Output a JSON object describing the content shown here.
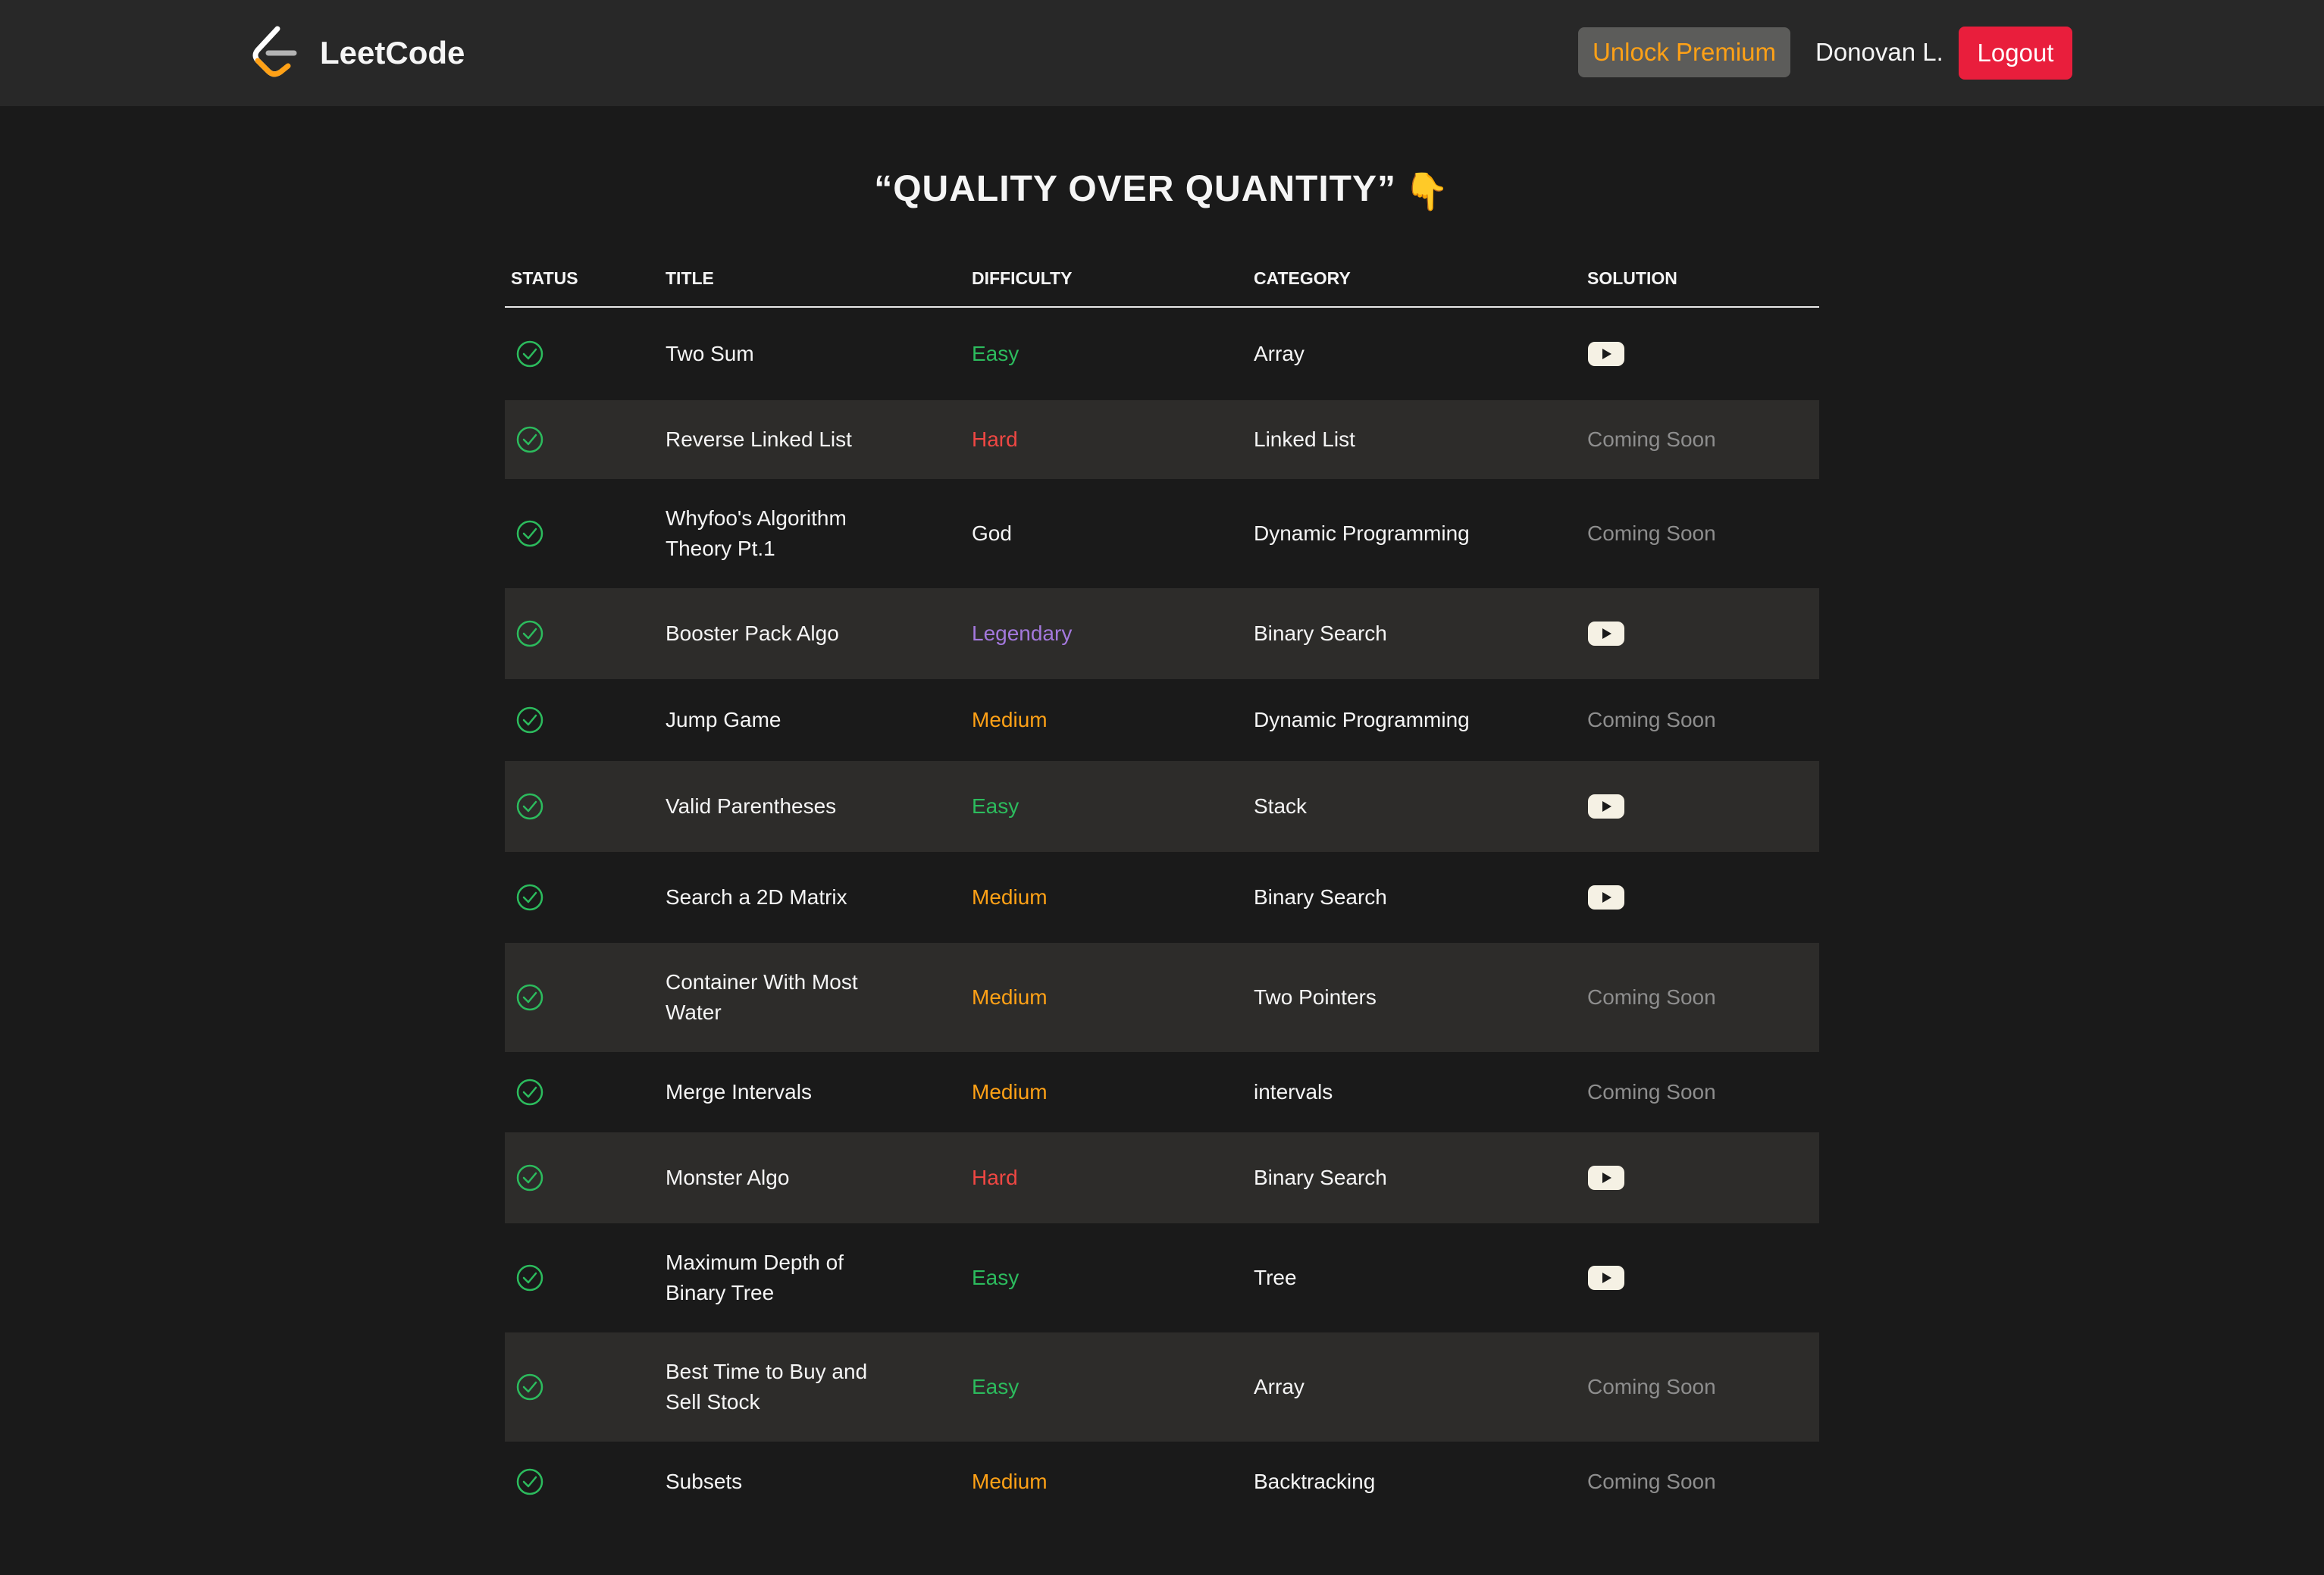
{
  "header": {
    "brand": "LeetCode",
    "premium_label": "Unlock Premium",
    "username": "Donovan L.",
    "logout_label": "Logout"
  },
  "heading": "“QUALITY OVER QUANTITY”",
  "heading_emoji": "👇",
  "columns": {
    "status": "STATUS",
    "title": "TITLE",
    "difficulty": "DIFFICULTY",
    "category": "CATEGORY",
    "solution": "SOLUTION"
  },
  "colors": {
    "Easy": "#2cbb5d",
    "Medium": "#ffa116",
    "Hard": "#ef4743",
    "Legendary": "#a378dc",
    "God": "#f5f5f5",
    "accent": "#ffa116",
    "logout": "#e91e3c"
  },
  "rows": [
    {
      "title": "Two Sum",
      "difficulty": "Easy",
      "category": "Array",
      "solution": "video"
    },
    {
      "title": "Reverse Linked List",
      "difficulty": "Hard",
      "category": "Linked List",
      "solution": "Coming Soon"
    },
    {
      "title": "Whyfoo's Algorithm Theory Pt.1",
      "difficulty": "God",
      "category": "Dynamic Programming",
      "solution": "Coming Soon"
    },
    {
      "title": "Booster Pack Algo",
      "difficulty": "Legendary",
      "category": "Binary Search",
      "solution": "video"
    },
    {
      "title": "Jump Game",
      "difficulty": "Medium",
      "category": "Dynamic Programming",
      "solution": "Coming Soon"
    },
    {
      "title": "Valid Parentheses",
      "difficulty": "Easy",
      "category": "Stack",
      "solution": "video"
    },
    {
      "title": "Search a 2D Matrix",
      "difficulty": "Medium",
      "category": "Binary Search",
      "solution": "video"
    },
    {
      "title": "Container With Most Water",
      "difficulty": "Medium",
      "category": "Two Pointers",
      "solution": "Coming Soon"
    },
    {
      "title": "Merge Intervals",
      "difficulty": "Medium",
      "category": "intervals",
      "solution": "Coming Soon"
    },
    {
      "title": "Monster Algo",
      "difficulty": "Hard",
      "category": "Binary Search",
      "solution": "video"
    },
    {
      "title": "Maximum Depth of Binary Tree",
      "difficulty": "Easy",
      "category": "Tree",
      "solution": "video"
    },
    {
      "title": "Best Time to Buy and Sell Stock",
      "difficulty": "Easy",
      "category": "Array",
      "solution": "Coming Soon"
    },
    {
      "title": "Subsets",
      "difficulty": "Medium",
      "category": "Backtracking",
      "solution": "Coming Soon"
    }
  ]
}
